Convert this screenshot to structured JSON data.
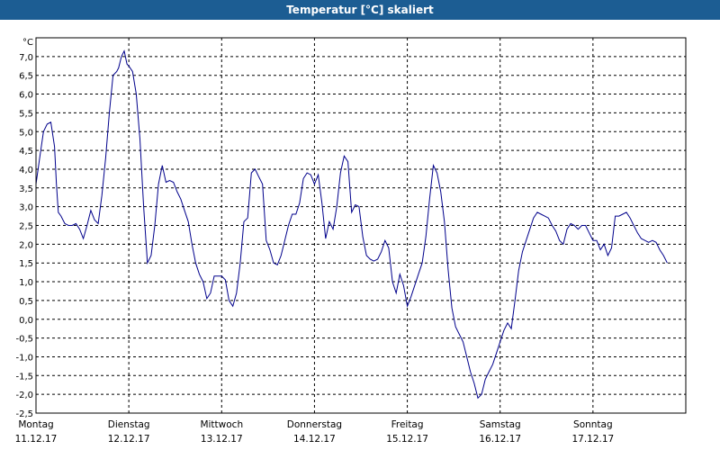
{
  "window": {
    "title": "Temperatur [°C] skaliert"
  },
  "chart_data": {
    "type": "line",
    "title": "Temperatur [°C] skaliert",
    "unit": "°C",
    "ylim": [
      -2.5,
      7.5
    ],
    "yticks": [
      -2.5,
      -2.0,
      -1.5,
      -1.0,
      -0.5,
      0.0,
      0.5,
      1.0,
      1.5,
      2.0,
      2.5,
      3.0,
      3.5,
      4.0,
      4.5,
      5.0,
      5.5,
      6.0,
      6.5,
      7.0
    ],
    "ytick_labels": [
      "-2,5",
      "-2,0",
      "-1,5",
      "-1,0",
      "-0,5",
      "0,0",
      "0,5",
      "1,0",
      "1,5",
      "2,0",
      "2,5",
      "3,0",
      "3,5",
      "4,0",
      "4,5",
      "5,0",
      "5,5",
      "6,0",
      "6,5",
      "7,0"
    ],
    "grid": true,
    "line_color": "#00008b",
    "days": [
      {
        "name": "Montag",
        "date": "11.12.17"
      },
      {
        "name": "Dienstag",
        "date": "12.12.17"
      },
      {
        "name": "Mittwoch",
        "date": "13.12.17"
      },
      {
        "name": "Donnerstag",
        "date": "14.12.17"
      },
      {
        "name": "Freitag",
        "date": "15.12.17"
      },
      {
        "name": "Samstag",
        "date": "16.12.17"
      },
      {
        "name": "Sonntag",
        "date": "17.12.17"
      }
    ],
    "xlim": [
      0,
      7
    ],
    "x": [
      0,
      0.04,
      0.08,
      0.12,
      0.16,
      0.2,
      0.22,
      0.24,
      0.27,
      0.31,
      0.35,
      0.39,
      0.43,
      0.47,
      0.51,
      0.55,
      0.59,
      0.63,
      0.67,
      0.71,
      0.75,
      0.79,
      0.83,
      0.87,
      0.89,
      0.92,
      0.95,
      0.98,
      1.0,
      1.04,
      1.08,
      1.12,
      1.16,
      1.2,
      1.24,
      1.28,
      1.32,
      1.36,
      1.4,
      1.44,
      1.48,
      1.52,
      1.56,
      1.6,
      1.64,
      1.68,
      1.72,
      1.76,
      1.8,
      1.84,
      1.88,
      1.92,
      1.96,
      2.0,
      2.04,
      2.08,
      2.12,
      2.16,
      2.2,
      2.24,
      2.28,
      2.32,
      2.36,
      2.4,
      2.44,
      2.48,
      2.52,
      2.56,
      2.6,
      2.64,
      2.68,
      2.72,
      2.76,
      2.8,
      2.84,
      2.88,
      2.92,
      2.96,
      3.0,
      3.04,
      3.08,
      3.12,
      3.16,
      3.2,
      3.24,
      3.28,
      3.32,
      3.36,
      3.4,
      3.44,
      3.48,
      3.52,
      3.56,
      3.6,
      3.64,
      3.68,
      3.72,
      3.76,
      3.8,
      3.84,
      3.88,
      3.92,
      3.96,
      4.0,
      4.04,
      4.08,
      4.12,
      4.16,
      4.2,
      4.24,
      4.28,
      4.32,
      4.36,
      4.4,
      4.44,
      4.48,
      4.52,
      4.56,
      4.6,
      4.64,
      4.68,
      4.72,
      4.76,
      4.8,
      4.84,
      4.88,
      4.92,
      4.96,
      5.0,
      5.04,
      5.08,
      5.12,
      5.16,
      5.2,
      5.24,
      5.28,
      5.32,
      5.36,
      5.4,
      5.44,
      5.48,
      5.52,
      5.56,
      5.6,
      5.64,
      5.68,
      5.72,
      5.76,
      5.8,
      5.84,
      5.88,
      5.92,
      5.96,
      6.0,
      6.04,
      6.08,
      6.12,
      6.16,
      6.2,
      6.24,
      6.28,
      6.32,
      6.36,
      6.4,
      6.44,
      6.48,
      6.52,
      6.56,
      6.6,
      6.64,
      6.68,
      6.72,
      6.76,
      6.8,
      6.84,
      6.88,
      6.92,
      6.96,
      7.0
    ],
    "series": [
      {
        "values": [
          3.6,
          4.3,
          5.0,
          5.2,
          5.25,
          4.6,
          3.6,
          2.85,
          2.75,
          2.55,
          2.5,
          2.5,
          2.55,
          2.4,
          2.15,
          2.5,
          2.9,
          2.65,
          2.55,
          3.3,
          4.3,
          5.5,
          6.5,
          6.6,
          6.7,
          7.0,
          7.15,
          6.8,
          6.75,
          6.6,
          6.0,
          4.8,
          3.0,
          1.5,
          1.7,
          2.5,
          3.6,
          4.1,
          3.65,
          3.7,
          3.65,
          3.4,
          3.2,
          2.9,
          2.6,
          2.0,
          1.5,
          1.2,
          1.0,
          0.55,
          0.7,
          1.15,
          1.15,
          1.15,
          1.05,
          0.5,
          0.35,
          0.7,
          1.5,
          2.6,
          2.7,
          3.9,
          4.0,
          3.8,
          3.6,
          2.1,
          1.85,
          1.5,
          1.45,
          1.7,
          2.1,
          2.5,
          2.8,
          2.8,
          3.1,
          3.75,
          3.9,
          3.85,
          3.6,
          3.85,
          3.1,
          2.15,
          2.6,
          2.4,
          3.0,
          3.9,
          4.35,
          4.2,
          2.85,
          3.05,
          3.0,
          2.2,
          1.7,
          1.6,
          1.55,
          1.6,
          1.8,
          2.1,
          1.9,
          1.0,
          0.7,
          1.2,
          0.9,
          0.35,
          0.6,
          0.9,
          1.2,
          1.5,
          2.2,
          3.2,
          4.1,
          3.9,
          3.4,
          2.6,
          1.3,
          0.3,
          -0.2,
          -0.4,
          -0.6,
          -1.0,
          -1.4,
          -1.7,
          -2.1,
          -2.0,
          -1.6,
          -1.4,
          -1.2,
          -0.9,
          -0.6,
          -0.3,
          -0.1,
          -0.25,
          0.5,
          1.3,
          1.8,
          2.1,
          2.4,
          2.7,
          2.85,
          2.8,
          2.75,
          2.7,
          2.5,
          2.35,
          2.1,
          2.0,
          2.4,
          2.55,
          2.5,
          2.4,
          2.5,
          2.5,
          2.3,
          2.1,
          2.1,
          1.85,
          2.0,
          1.7,
          1.9,
          2.75,
          2.75,
          2.8,
          2.85,
          2.7,
          2.5,
          2.3,
          2.15,
          2.1,
          2.05,
          2.1,
          2.05,
          1.85,
          1.7,
          1.5
        ]
      }
    ]
  }
}
